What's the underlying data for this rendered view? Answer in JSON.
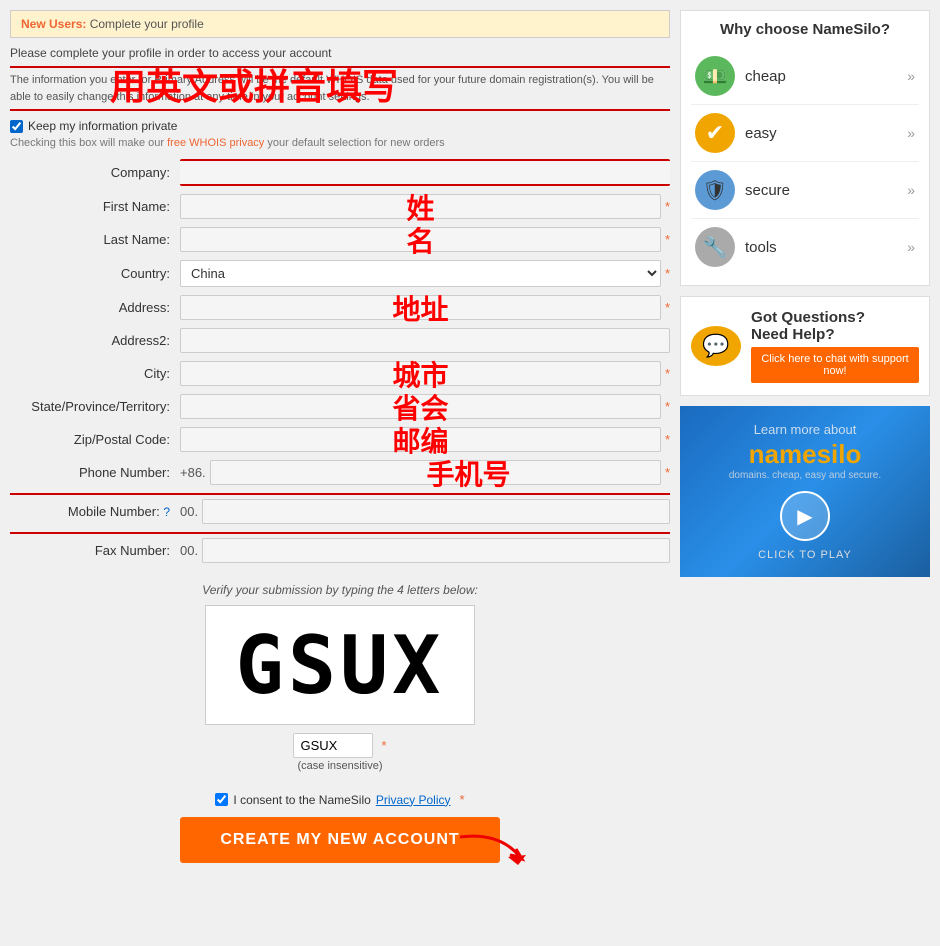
{
  "banner": {
    "label": "New Users:",
    "text": "Complete your profile"
  },
  "complete_text": "Please complete your profile in order to access your account",
  "info_text": "The information you enter for Primary Address will be the default WHOIS data used for your future domain registration(s). You will be able to easily change this information at any time in your account settings.",
  "overlay_hint": "用英文或拼音填写",
  "privacy_checkbox_label": "Keep my information private",
  "privacy_note": "Checking this box will make our free WHOIS privacy your default selection for new orders",
  "form": {
    "company_label": "Company:",
    "firstname_label": "First Name:",
    "firstname_overlay": "姓",
    "lastname_label": "Last Name:",
    "lastname_overlay": "名",
    "country_label": "Country:",
    "country_value": "China",
    "address_label": "Address:",
    "address_overlay": "地址",
    "address2_label": "Address2:",
    "city_label": "City:",
    "city_overlay": "城市",
    "state_label": "State/Province/Territory:",
    "state_overlay": "省会",
    "zip_label": "Zip/Postal Code:",
    "zip_overlay": "邮编",
    "phone_label": "Phone Number:",
    "phone_overlay": "手机号",
    "phone_prefix": "+86.",
    "mobile_label": "Mobile Number:",
    "mobile_prefix": "00.",
    "fax_label": "Fax Number:",
    "fax_prefix": "00."
  },
  "captcha": {
    "label": "Verify your submission by typing the 4 letters below:",
    "code": "GSUX",
    "input_value": "GSUX",
    "case_note": "(case insensitive)"
  },
  "consent": {
    "label": "I consent to the NameSilo",
    "link": "Privacy Policy"
  },
  "submit_button": "CREATE MY NEW ACCOUNT",
  "sidebar": {
    "title": "Why choose NameSilo?",
    "items": [
      {
        "id": "cheap",
        "label": "cheap",
        "icon": "💵",
        "icon_class": "icon-cheap"
      },
      {
        "id": "easy",
        "label": "easy",
        "icon": "✔",
        "icon_class": "icon-easy"
      },
      {
        "id": "secure",
        "label": "secure",
        "icon": "🛡",
        "icon_class": "icon-secure"
      },
      {
        "id": "tools",
        "label": "tools",
        "icon": "🔧",
        "icon_class": "icon-tools"
      }
    ],
    "support_heading1": "Got Questions?",
    "support_heading2": "Need Help?",
    "support_btn": "Click here to chat with support now!",
    "video_learn": "Learn more about",
    "video_brand1": "name",
    "video_brand2": "silo",
    "video_tagline": "domains. cheap, easy and secure.",
    "video_cta": "CLICK TO PLAY"
  }
}
